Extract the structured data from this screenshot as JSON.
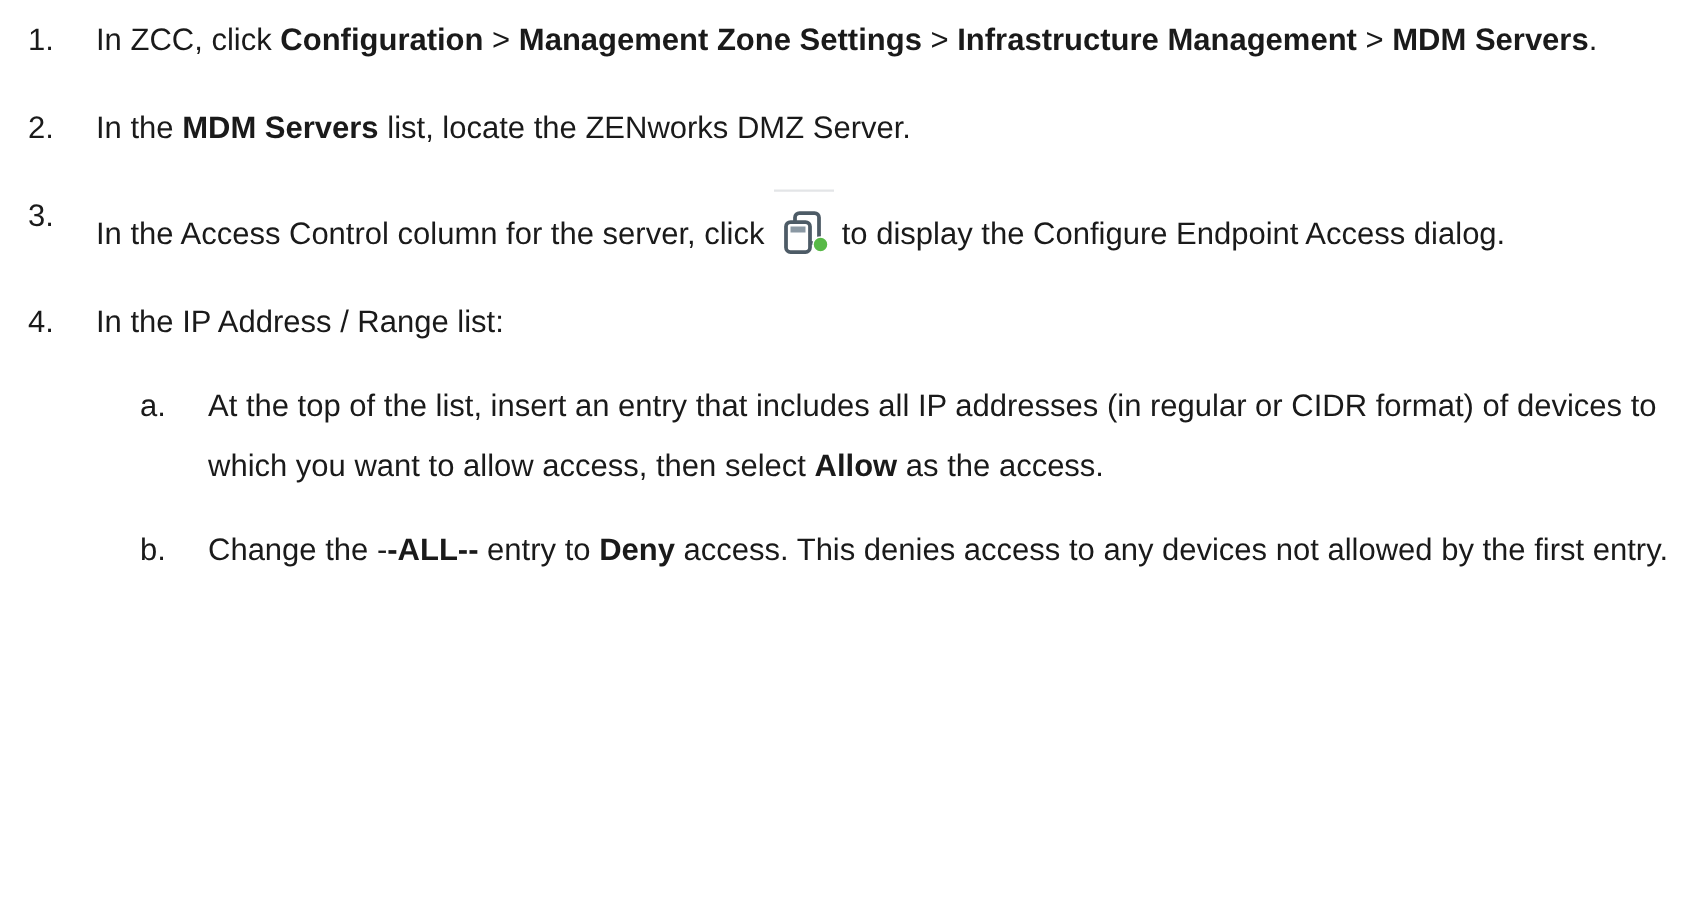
{
  "steps": [
    {
      "number": "1.",
      "kind": "text",
      "text": "In ZCC, click **Configuration** > **Management Zone Settings** > **Infrastructure Management** > **MDM Servers**."
    },
    {
      "number": "2.",
      "kind": "text",
      "text": "In the **MDM Servers** list, locate the ZENworks DMZ Server."
    },
    {
      "number": "3.",
      "kind": "icon",
      "text_before": "In the Access Control column for the server, click",
      "text_after": "to display the Configure Endpoint Access dialog."
    },
    {
      "number": "4.",
      "kind": "text",
      "text": "In the IP Address / Range list:",
      "substeps": [
        {
          "letter": "a.",
          "text": "At the top of the list, insert an entry that includes all IP addresses (in regular or CIDR format) of devices to which you want to allow access, then select **Allow** as the access."
        },
        {
          "letter": "b.",
          "text": "Change the -**-ALL--** entry to **Deny** access. This denies access to any devices not allowed by the first entry."
        }
      ]
    }
  ]
}
